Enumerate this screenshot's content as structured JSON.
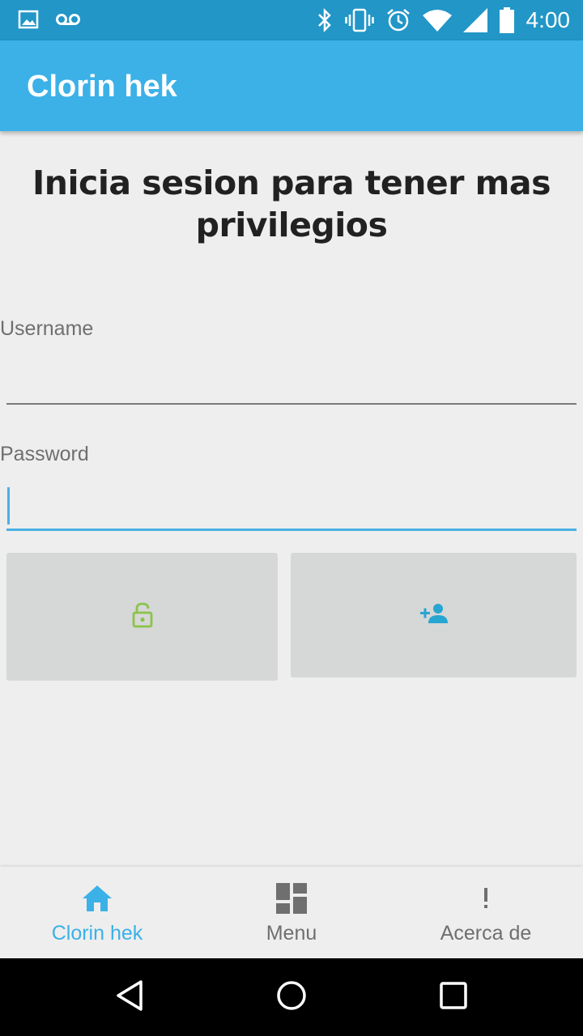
{
  "status_bar": {
    "time": "4:00",
    "icons_left": [
      "image-icon",
      "voicemail-icon"
    ],
    "icons_right": [
      "bluetooth-icon",
      "vibrate-icon",
      "alarm-icon",
      "wifi-icon",
      "signal-icon",
      "battery-icon"
    ]
  },
  "app_bar": {
    "title": "Clorin hek"
  },
  "main": {
    "heading": "Inicia sesion para tener mas privilegios",
    "username_label": "Username",
    "username_value": "",
    "password_label": "Password",
    "password_value": ""
  },
  "buttons": {
    "login_icon": "lock-open-icon",
    "register_icon": "person-add-icon"
  },
  "bottom_nav": {
    "items": [
      {
        "label": "Clorin hek",
        "icon": "home-icon",
        "active": true
      },
      {
        "label": "Menu",
        "icon": "dashboard-icon",
        "active": false
      },
      {
        "label": "Acerca de",
        "icon": "exclamation-icon",
        "active": false
      }
    ]
  },
  "colors": {
    "status_bar": "#2196c7",
    "app_bar": "#3bb1e8",
    "accent": "#3bb1e8",
    "login_icon": "#8bc34a",
    "register_icon": "#26a6d1",
    "background": "#eeeeee"
  }
}
